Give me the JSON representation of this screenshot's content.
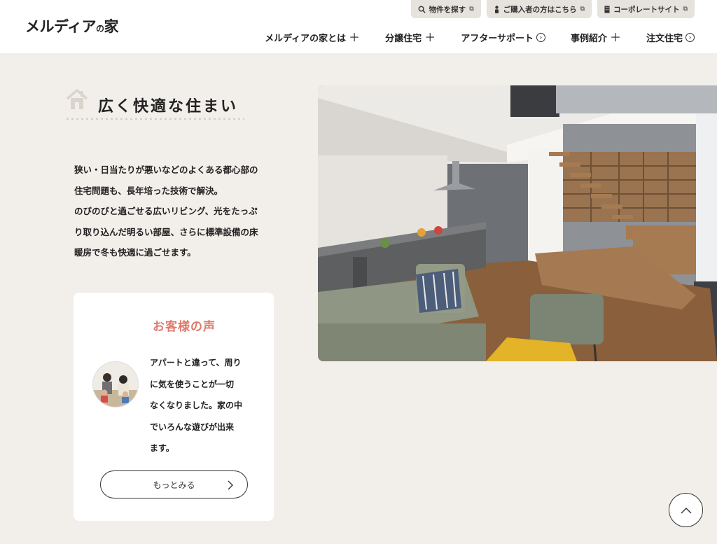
{
  "header": {
    "logo_main": "メルディア",
    "logo_no": "の",
    "logo_end": "家",
    "top_links": [
      {
        "icon": "search-icon",
        "label": "物件を探す"
      },
      {
        "icon": "person-icon",
        "label": "ご購入者の方はこちら"
      },
      {
        "icon": "building-icon",
        "label": "コーポレートサイト"
      }
    ],
    "nav": [
      {
        "label": "メルディアの家とは",
        "marker": "+"
      },
      {
        "label": "分譲住宅",
        "marker": "+"
      },
      {
        "label": "アフターサポート",
        "marker": ">"
      },
      {
        "label": "事例紹介",
        "marker": "+"
      },
      {
        "label": "注文住宅",
        "marker": ">"
      }
    ]
  },
  "section": {
    "title": "広く快適な住まい",
    "lead_lines": [
      "狭い・日当たりが悪いなどのよくある都心部の",
      "住宅問題も、長年培った技術で解決。",
      "のびのびと過ごせる広いリビング、光をたっぷ",
      "り取り込んだ明るい部屋、さらに標準設備の床",
      "暖房で冬も快適に過ごせます。"
    ]
  },
  "voice": {
    "title": "お客様の声",
    "lines": [
      "アパートと違って、周り",
      "に気を使うことが一切",
      "なくなりました。家の中",
      "でいろんな遊びが出来",
      "ます。"
    ],
    "more_label": "もっとみる"
  },
  "colors": {
    "accent": "#de7a6a",
    "background": "#f2efeb",
    "tab_bg": "#e6e2dc"
  }
}
